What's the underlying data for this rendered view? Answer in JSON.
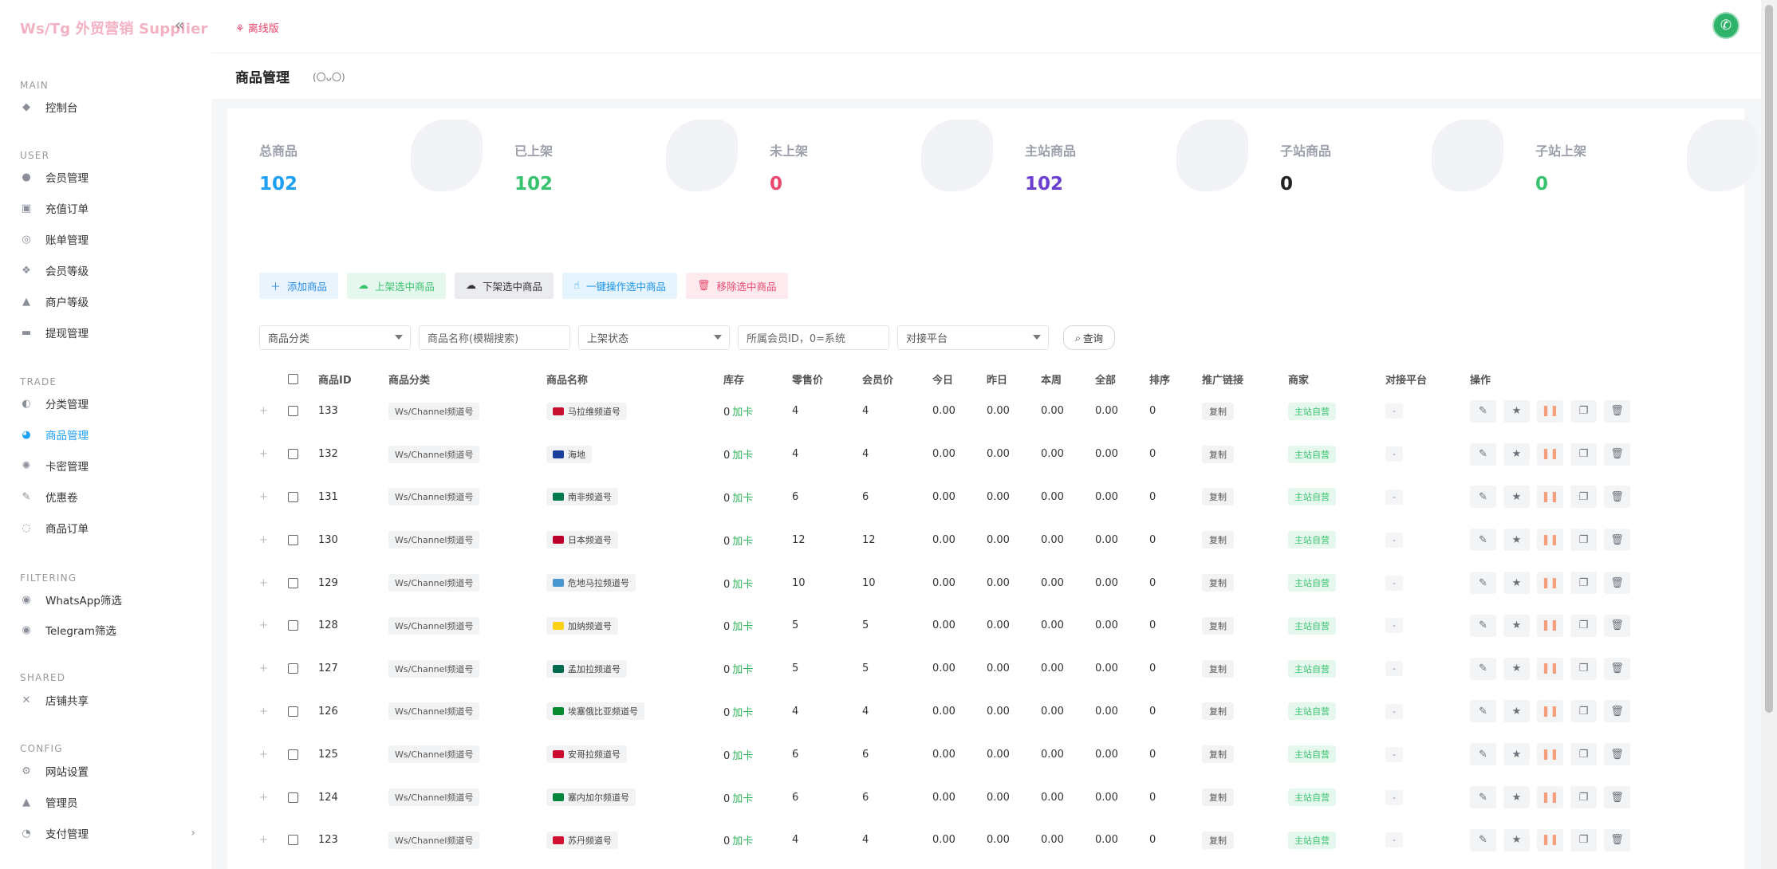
{
  "brand": "Ws/Tg 外贸营销 Supplier",
  "sidebar": {
    "sections": [
      {
        "title": "MAIN",
        "items": [
          {
            "label": "控制台",
            "icon": "dashboard-icon"
          }
        ]
      },
      {
        "title": "USER",
        "items": [
          {
            "label": "会员管理",
            "icon": "user-icon"
          },
          {
            "label": "充值订单",
            "icon": "recharge-icon"
          },
          {
            "label": "账单管理",
            "icon": "bill-icon"
          },
          {
            "label": "会员等级",
            "icon": "level-icon"
          },
          {
            "label": "商户等级",
            "icon": "merchant-level-icon"
          },
          {
            "label": "提现管理",
            "icon": "withdraw-icon"
          }
        ]
      },
      {
        "title": "TRADE",
        "items": [
          {
            "label": "分类管理",
            "icon": "category-icon"
          },
          {
            "label": "商品管理",
            "icon": "goods-icon"
          },
          {
            "label": "卡密管理",
            "icon": "card-key-icon"
          },
          {
            "label": "优惠卷",
            "icon": "coupon-icon"
          },
          {
            "label": "商品订单",
            "icon": "order-icon"
          }
        ]
      },
      {
        "title": "FILTERING",
        "items": [
          {
            "label": "WhatsApp筛选",
            "icon": "whatsapp-filter-icon"
          },
          {
            "label": "Telegram筛选",
            "icon": "telegram-filter-icon"
          }
        ]
      },
      {
        "title": "SHARED",
        "items": [
          {
            "label": "店铺共享",
            "icon": "share-icon"
          }
        ]
      },
      {
        "title": "CONFIG",
        "items": [
          {
            "label": "网站设置",
            "icon": "settings-icon"
          },
          {
            "label": "管理员",
            "icon": "admin-icon"
          },
          {
            "label": "支付管理",
            "icon": "payment-icon"
          }
        ]
      }
    ]
  },
  "header": {
    "offline_label": "离线版"
  },
  "page": {
    "title": "商品管理",
    "subtitle": "(〇ᴗ〇)"
  },
  "stats": [
    {
      "label": "总商品",
      "value": "102",
      "color": "#1e9ff2"
    },
    {
      "label": "已上架",
      "value": "102",
      "color": "#39c36f"
    },
    {
      "label": "未上架",
      "value": "0",
      "color": "#e8486d"
    },
    {
      "label": "主站商品",
      "value": "102",
      "color": "#6a3fd0"
    },
    {
      "label": "子站商品",
      "value": "0",
      "color": "#222222"
    },
    {
      "label": "子站上架",
      "value": "0",
      "color": "#39c36f"
    }
  ],
  "buttons": {
    "add": "添加商品",
    "list_selected": "上架选中商品",
    "delist_selected": "下架选中商品",
    "one_click": "一键操作选中商品",
    "remove_selected": "移除选中商品"
  },
  "filters": {
    "category": "商品分类",
    "name_placeholder": "商品名称(模糊搜索)",
    "status": "上架状态",
    "member_placeholder": "所属会员ID，0=系统",
    "platform": "对接平台",
    "query": "查询"
  },
  "table": {
    "headers": [
      "商品ID",
      "商品分类",
      "商品名称",
      "库存",
      "零售价",
      "会员价",
      "今日",
      "昨日",
      "本周",
      "全部",
      "排序",
      "推广链接",
      "商家",
      "对接平台",
      "操作"
    ],
    "add_card": "加卡",
    "copy": "复制",
    "merchant": "主站自营",
    "platform_dash": "-",
    "rows": [
      {
        "id": "133",
        "category": "Ws/Channel频道号",
        "name": "马拉维频道号",
        "flag": "#c8102e",
        "stock": "0",
        "retail": "4",
        "member": "4",
        "today": "0.00",
        "yesterday": "0.00",
        "week": "0.00",
        "all": "0.00",
        "sort": "0"
      },
      {
        "id": "132",
        "category": "Ws/Channel频道号",
        "name": "海地",
        "flag": "#1a3f9c",
        "stock": "0",
        "retail": "4",
        "member": "4",
        "today": "0.00",
        "yesterday": "0.00",
        "week": "0.00",
        "all": "0.00",
        "sort": "0"
      },
      {
        "id": "131",
        "category": "Ws/Channel频道号",
        "name": "南非频道号",
        "flag": "#007a4d",
        "stock": "0",
        "retail": "6",
        "member": "6",
        "today": "0.00",
        "yesterday": "0.00",
        "week": "0.00",
        "all": "0.00",
        "sort": "0"
      },
      {
        "id": "130",
        "category": "Ws/Channel频道号",
        "name": "日本频道号",
        "flag": "#bc002d",
        "stock": "0",
        "retail": "12",
        "member": "12",
        "today": "0.00",
        "yesterday": "0.00",
        "week": "0.00",
        "all": "0.00",
        "sort": "0"
      },
      {
        "id": "129",
        "category": "Ws/Channel频道号",
        "name": "危地马拉频道号",
        "flag": "#4997d0",
        "stock": "0",
        "retail": "10",
        "member": "10",
        "today": "0.00",
        "yesterday": "0.00",
        "week": "0.00",
        "all": "0.00",
        "sort": "0"
      },
      {
        "id": "128",
        "category": "Ws/Channel频道号",
        "name": "加纳频道号",
        "flag": "#fcd116",
        "stock": "0",
        "retail": "5",
        "member": "5",
        "today": "0.00",
        "yesterday": "0.00",
        "week": "0.00",
        "all": "0.00",
        "sort": "0"
      },
      {
        "id": "127",
        "category": "Ws/Channel频道号",
        "name": "孟加拉频道号",
        "flag": "#006a4e",
        "stock": "0",
        "retail": "5",
        "member": "5",
        "today": "0.00",
        "yesterday": "0.00",
        "week": "0.00",
        "all": "0.00",
        "sort": "0"
      },
      {
        "id": "126",
        "category": "Ws/Channel频道号",
        "name": "埃塞俄比亚频道号",
        "flag": "#078930",
        "stock": "0",
        "retail": "4",
        "member": "4",
        "today": "0.00",
        "yesterday": "0.00",
        "week": "0.00",
        "all": "0.00",
        "sort": "0"
      },
      {
        "id": "125",
        "category": "Ws/Channel频道号",
        "name": "安哥拉频道号",
        "flag": "#cc092f",
        "stock": "0",
        "retail": "6",
        "member": "6",
        "today": "0.00",
        "yesterday": "0.00",
        "week": "0.00",
        "all": "0.00",
        "sort": "0"
      },
      {
        "id": "124",
        "category": "Ws/Channel频道号",
        "name": "塞内加尔频道号",
        "flag": "#00853f",
        "stock": "0",
        "retail": "6",
        "member": "6",
        "today": "0.00",
        "yesterday": "0.00",
        "week": "0.00",
        "all": "0.00",
        "sort": "0"
      },
      {
        "id": "123",
        "category": "Ws/Channel频道号",
        "name": "苏丹频道号",
        "flag": "#d21034",
        "stock": "0",
        "retail": "4",
        "member": "4",
        "today": "0.00",
        "yesterday": "0.00",
        "week": "0.00",
        "all": "0.00",
        "sort": "0"
      }
    ]
  }
}
